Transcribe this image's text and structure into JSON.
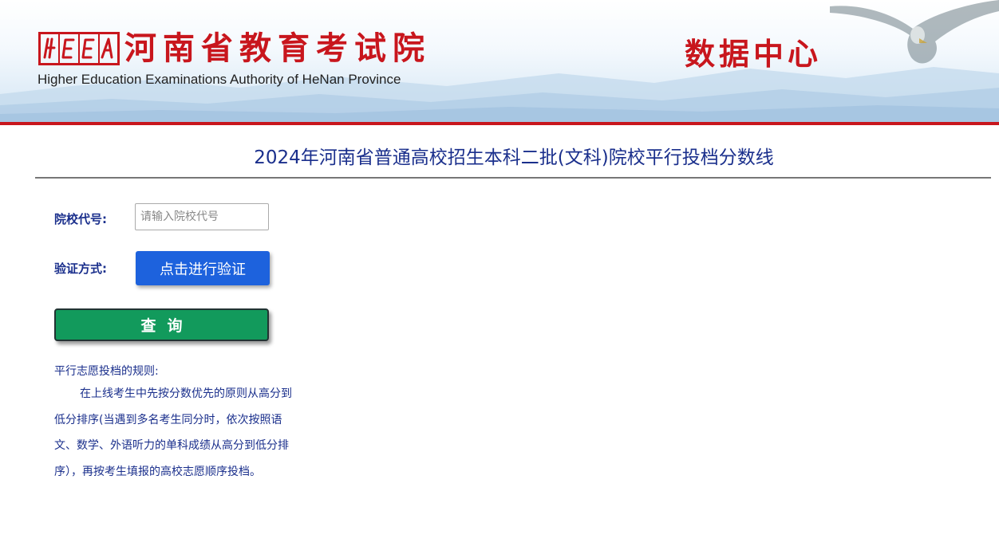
{
  "header": {
    "logo_text": "HEEA",
    "cn_title": "河南省教育考试院",
    "en_title": "Higher Education Examinations Authority of HeNan Province",
    "data_center": "数据中心"
  },
  "page": {
    "title": "2024年河南省普通高校招生本科二批(文科)院校平行投档分数线"
  },
  "form": {
    "code_label": "院校代号:",
    "code_placeholder": "请输入院校代号",
    "code_value": "",
    "verify_label": "验证方式:",
    "verify_button": "点击进行验证",
    "query_button": "查询"
  },
  "rules": {
    "title": "平行志愿投档的规则:",
    "body": "在上线考生中先按分数优先的原则从高分到低分排序(当遇到多名考生同分时，依次按照语文、数学、外语听力的单科成绩从高分到低分排序），再按考生填报的高校志愿顺序投档。"
  },
  "colors": {
    "brand_red": "#c8161d",
    "title_blue": "#1a2f8c",
    "verify_blue": "#1d62dd",
    "query_green": "#129a5c"
  }
}
